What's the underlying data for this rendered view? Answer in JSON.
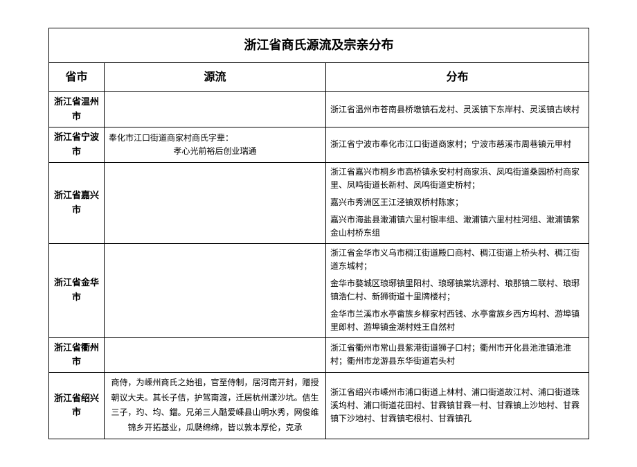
{
  "title": "浙江省商氏源流及宗亲分布",
  "headers": {
    "province": "省市",
    "origin": "源流",
    "distribution": "分布"
  },
  "rows": [
    {
      "province": "浙江省温州市",
      "origin": "",
      "distribution": "浙江省温州市苍南县桥墩镇石龙村、灵溪镇下东岸村、灵溪镇古峡村"
    },
    {
      "province": "浙江省宁波市",
      "origin_line1": "奉化市江口街道商家村商氏字辈：",
      "origin_line2": "孝心光前裕后创业瑞通",
      "distribution": "浙江省宁波市奉化市江口街道商家村；宁波市慈溪市周巷镇元甲村"
    },
    {
      "province": "浙江省嘉兴市",
      "origin": "",
      "dist_p1": "浙江省嘉兴市桐乡市高桥镇永安村村商家浜、凤鸣街道桑园桥村商家里、凤鸣街道长新村、凤鸣街道史桥村；",
      "dist_p2": "嘉兴市秀洲区王江泾镇双桥村陈家；",
      "dist_p3": "嘉兴市海盐县澉浦镇六里村银丰组、澉浦镇六里村柱河组、澉浦镇紫金山村桥东组"
    },
    {
      "province": "浙江省金华市",
      "origin": "",
      "dist_p1": "浙江省金华市义乌市稠江街道殿口商村、稠江街道上桥头村、稠江街道东城村；",
      "dist_p2": "金华市婺城区琅琊镇里阳村、琅琊镇棠坑源村、琅那镇二联村、琅琊镇浩仁村、新狮街道十里牌楼村；",
      "dist_p3": "金华市兰溪市水亭畲族乡柳家村西钱、水亭畲族乡西方坞村、游埠镇里郎村、游埠镇金湖村姓王自然村"
    },
    {
      "province": "浙江省衢州市",
      "origin": "",
      "distribution": "浙江省衢州市常山县紫港街道狮子口村；衢州市开化县池淮镇池淮村；衢州市龙游县东华街道岩头村"
    },
    {
      "province": "浙江省绍兴市",
      "origin": "商侍，为嵊州商氏之始祖，官至侍制，居河南开封，赠授朝议大夫。其长子佶，护驾南渡，迁居杭州漾沙坑。佶生三子，玓、均、鐺。兄弟三人酷爱嵊县山明水秀，网俊维锦乡开拓基业，瓜瓞绵绵，皆以敦本厚伦，克承",
      "distribution": "浙江省绍兴市嵊州市浦口街道上林村、浦口街道故江村、浦口街道珠溪坞村、浦口街道花田村、甘霖镇甘霖一村、甘霖镇上沙地村、甘霖镇下沙地村、甘霖镇宅根村、甘霖镇孔"
    }
  ]
}
